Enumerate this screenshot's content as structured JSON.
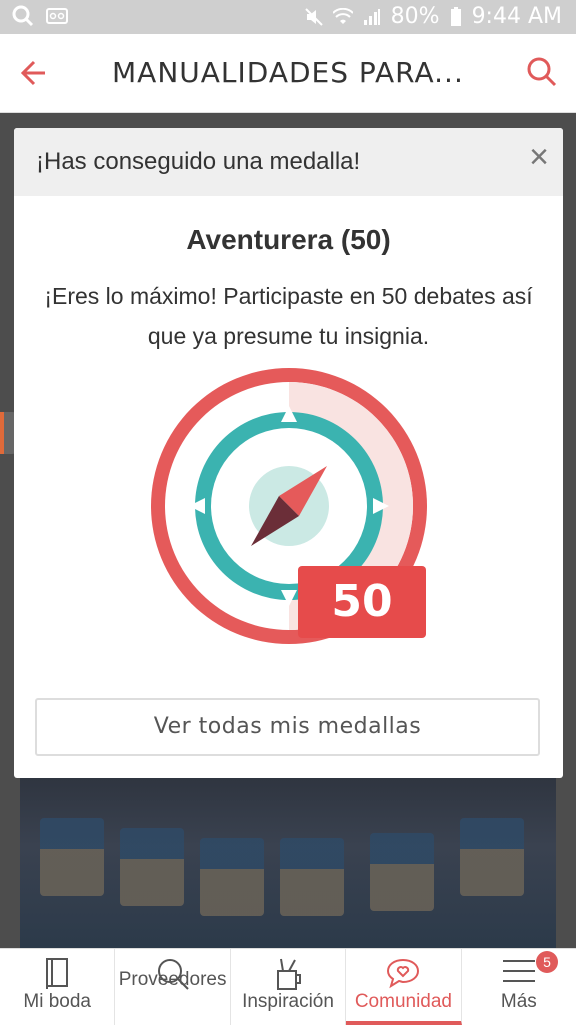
{
  "status": {
    "battery": "80%",
    "time": "9:44 AM"
  },
  "header": {
    "title": "MANUALIDADES PARA..."
  },
  "modal": {
    "heading": "¡Has conseguido una medalla!",
    "medal_name": "Aventurera (50)",
    "description": "¡Eres lo máximo! Participaste en 50 debates así que ya presume tu insignia.",
    "badge_number": "50",
    "button_label": "Ver todas mis medallas",
    "close_symbol": "×"
  },
  "tabs": [
    {
      "label": "Mi boda",
      "icon": "notebook-icon"
    },
    {
      "label": "Proveedores",
      "icon": "search-icon"
    },
    {
      "label": "Inspiración",
      "icon": "pencil-cup-icon"
    },
    {
      "label": "Comunidad",
      "icon": "chat-heart-icon",
      "active": true
    },
    {
      "label": "Más",
      "icon": "menu-icon",
      "badge": "5"
    }
  ],
  "colors": {
    "accent": "#e05a5a",
    "teal": "#3bb3b0",
    "red": "#e55a5a"
  }
}
